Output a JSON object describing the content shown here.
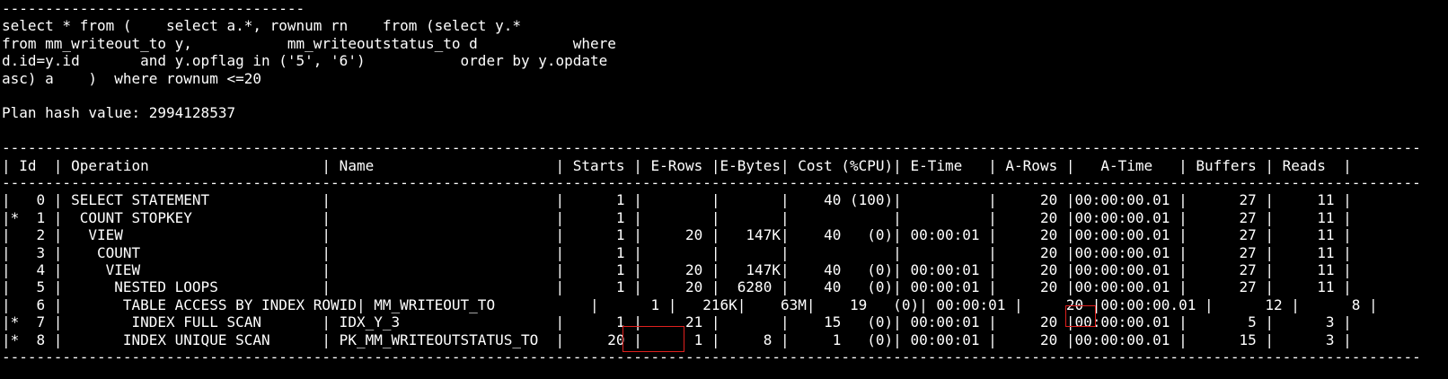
{
  "terminal": {
    "background": "#000000",
    "text_color": "#ffffff",
    "highlight_color": "#e0201e",
    "lines": [
      "-----------------------------------",
      "select * from (    select a.*, rownum rn    from (select y.*",
      "from mm_writeout_to y,           mm_writeoutstatus_to d           where",
      "d.id=y.id       and y.opflag in ('5', '6')           order by y.opdate",
      "asc) a    )  where rownum <=20",
      "",
      "Plan hash value: 2994128537",
      "",
      "--------------------------------------------------------------------------------------------------------------------------------------------------------------------",
      "| Id  | Operation                    | Name                     | Starts | E-Rows |E-Bytes| Cost (%CPU)| E-Time   | A-Rows |   A-Time   | Buffers | Reads  |",
      "--------------------------------------------------------------------------------------------------------------------------------------------------------------------",
      "|   0 | SELECT STATEMENT             |                          |      1 |        |       |    40 (100)|          |     20 |00:00:00.01 |      27 |     11 |",
      "|*  1 |  COUNT STOPKEY               |                          |      1 |        |       |            |          |     20 |00:00:00.01 |      27 |     11 |",
      "|   2 |   VIEW                       |                          |      1 |     20 |   147K|    40   (0)| 00:00:01 |     20 |00:00:00.01 |      27 |     11 |",
      "|   3 |    COUNT                     |                          |      1 |        |       |            |          |     20 |00:00:00.01 |      27 |     11 |",
      "|   4 |     VIEW                     |                          |      1 |     20 |   147K|    40   (0)| 00:00:01 |     20 |00:00:00.01 |      27 |     11 |",
      "|   5 |      NESTED LOOPS            |                          |      1 |     20 |  6280 |    40   (0)| 00:00:01 |     20 |00:00:00.01 |      27 |     11 |",
      "|   6 |       TABLE ACCESS BY INDEX ROWID| MM_WRITEOUT_TO           |      1 |   216K|    63M|    19   (0)| 00:00:01 |     20 |00:00:00.01 |      12 |      8 |",
      "|*  7 |        INDEX FULL SCAN       | IDX_Y_3                  |      1 |     21 |       |    15   (0)| 00:00:01 |     20 |00:00:00.01 |       5 |      3 |",
      "|*  8 |       INDEX UNIQUE SCAN      | PK_MM_WRITEOUTSTATUS_TO  |     20 |      1 |     8 |     1   (0)| 00:00:01 |     20 |00:00:00.01 |      15 |      3 |",
      "--------------------------------------------------------------------------------------------------------------------------------------------------------------------"
    ]
  }
}
